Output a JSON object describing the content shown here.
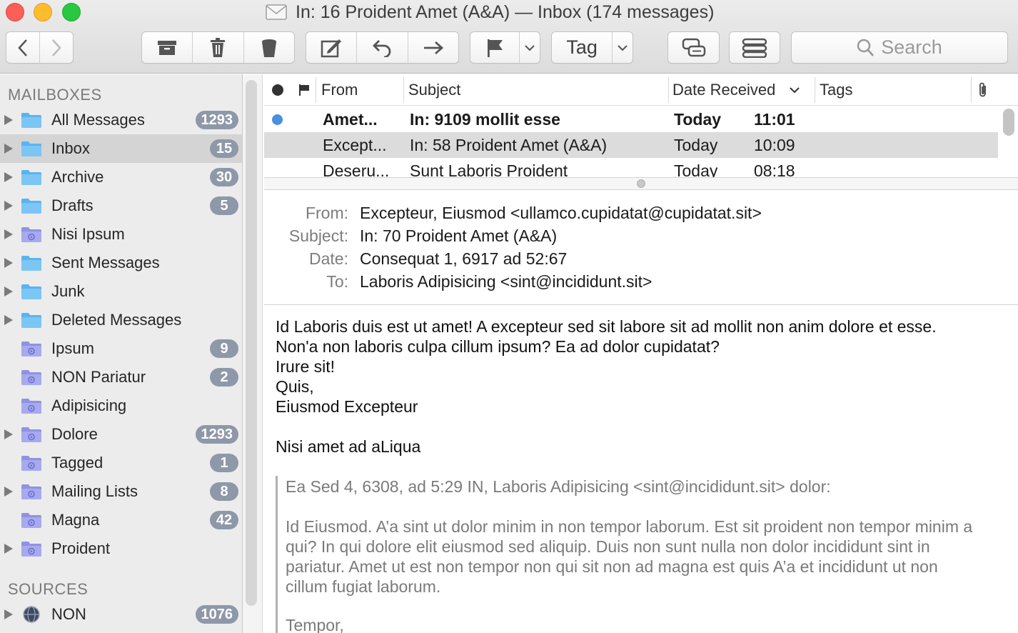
{
  "window": {
    "title": "In: 16 Proident Amet (A&A) — Inbox (174 messages)"
  },
  "toolbar": {
    "tag_label": "Tag",
    "search_placeholder": "Search"
  },
  "sidebar": {
    "mailboxes_heading": "MAILBOXES",
    "sources_heading": "SOURCES",
    "items": [
      {
        "label": "All Messages",
        "badge": "1293",
        "disclosure": true,
        "folder": "blue"
      },
      {
        "label": "Inbox",
        "badge": "15",
        "disclosure": true,
        "folder": "blue",
        "selected": true
      },
      {
        "label": "Archive",
        "badge": "30",
        "disclosure": true,
        "folder": "blue"
      },
      {
        "label": "Drafts",
        "badge": "5",
        "disclosure": true,
        "folder": "blue"
      },
      {
        "label": "Nisi Ipsum",
        "badge": "",
        "disclosure": true,
        "folder": "smart"
      },
      {
        "label": "Sent Messages",
        "badge": "",
        "disclosure": true,
        "folder": "blue"
      },
      {
        "label": "Junk",
        "badge": "",
        "disclosure": true,
        "folder": "blue"
      },
      {
        "label": "Deleted Messages",
        "badge": "",
        "disclosure": true,
        "folder": "blue"
      },
      {
        "label": "Ipsum",
        "badge": "9",
        "disclosure": false,
        "folder": "smart"
      },
      {
        "label": "NON Pariatur",
        "badge": "2",
        "disclosure": false,
        "folder": "smart"
      },
      {
        "label": "Adipisicing",
        "badge": "",
        "disclosure": false,
        "folder": "smart"
      },
      {
        "label": "Dolore",
        "badge": "1293",
        "disclosure": true,
        "folder": "smart"
      },
      {
        "label": "Tagged",
        "badge": "1",
        "disclosure": false,
        "folder": "smart"
      },
      {
        "label": "Mailing Lists",
        "badge": "8",
        "disclosure": true,
        "folder": "smart"
      },
      {
        "label": "Magna",
        "badge": "42",
        "disclosure": false,
        "folder": "smart"
      },
      {
        "label": "Proident",
        "badge": "",
        "disclosure": true,
        "folder": "smart"
      }
    ],
    "sources": [
      {
        "label": "NON",
        "badge": "1076",
        "disclosure": true,
        "icon": "globe-icon"
      }
    ]
  },
  "message_list": {
    "columns": {
      "from": "From",
      "subject": "Subject",
      "date_received": "Date Received",
      "tags": "Tags"
    },
    "rows": [
      {
        "from": "Amet...",
        "subject": "In: 9109 mollit esse",
        "date": "Today",
        "time": "11:01",
        "unread": true
      },
      {
        "from": "Except...",
        "subject": "In: 58 Proident Amet (A&A)",
        "date": "Today",
        "time": "10:09",
        "selected": true
      },
      {
        "from": "Deseru...",
        "subject": "Sunt Laboris Proident",
        "date": "Today",
        "time": "08:18"
      }
    ]
  },
  "message": {
    "from_key": "From:",
    "from": "Excepteur, Eiusmod <ullamco.cupidatat@cupidatat.sit>",
    "subject_key": "Subject:",
    "subject": "In: 70 Proident Amet (A&A)",
    "date_key": "Date:",
    "date": "Consequat 1, 6917 ad 52:67",
    "to_key": "To:",
    "to": "Laboris Adipisicing <sint@incididunt.sit>",
    "body": [
      "Id Laboris duis est ut amet! A excepteur sed sit labore sit ad mollit non anim dolore et esse.",
      "Non'a non laboris culpa cillum ipsum? Ea ad dolor cupidatat?",
      "Irure sit!",
      "Quis,",
      "Eiusmod Excepteur",
      "Nisi amet ad aLiqua"
    ],
    "quote": [
      "Ea Sed 4, 6308, ad 5:29 IN, Laboris Adipisicing <sint@incididunt.sit> dolor:",
      "Id Eiusmod. A’a sint ut dolor minim in non tempor laborum. Est sit proident non tempor minim a",
      "qui? In qui dolore elit eiusmod sed aliquip. Duis non sunt nulla non dolor incididunt sint in",
      "pariatur. Amet ut est non tempor non qui sit non ad magna est quis A’a et incididunt ut non",
      "cillum fugiat laborum.",
      "Tempor,"
    ]
  },
  "colors": {
    "badge": "#8e98a8",
    "unread_dot": "#4a90e2",
    "folder_blue": "#5ab4ef",
    "folder_smart": "#9a9ee6",
    "selection": "#dcdcdc"
  }
}
